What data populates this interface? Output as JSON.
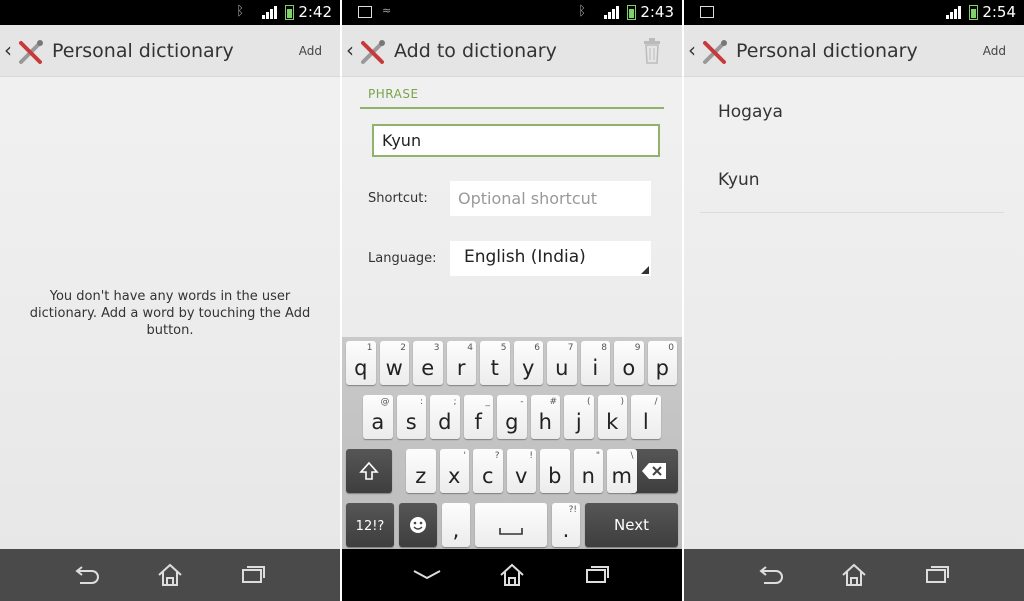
{
  "panel1": {
    "status_time": "2:42",
    "title": "Personal dictionary",
    "add_label": "Add",
    "empty_message": "You don't have any words in the user dictionary. Add a word by touching the Add button."
  },
  "panel2": {
    "status_time": "2:43",
    "title": "Add to dictionary",
    "phrase_label": "PHRASE",
    "phrase_value": "Kyun",
    "shortcut_label": "Shortcut:",
    "shortcut_placeholder": "Optional shortcut",
    "language_label": "Language:",
    "language_value": "English (India)",
    "keyboard": {
      "row1": [
        {
          "k": "q",
          "s": "1"
        },
        {
          "k": "w",
          "s": "2"
        },
        {
          "k": "e",
          "s": "3"
        },
        {
          "k": "r",
          "s": "4"
        },
        {
          "k": "t",
          "s": "5"
        },
        {
          "k": "y",
          "s": "6"
        },
        {
          "k": "u",
          "s": "7"
        },
        {
          "k": "i",
          "s": "8"
        },
        {
          "k": "o",
          "s": "9"
        },
        {
          "k": "p",
          "s": "0"
        }
      ],
      "row2": [
        {
          "k": "a",
          "s": "@"
        },
        {
          "k": "s",
          "s": ":"
        },
        {
          "k": "d",
          "s": ";"
        },
        {
          "k": "f",
          "s": "_"
        },
        {
          "k": "g",
          "s": "-"
        },
        {
          "k": "h",
          "s": "#"
        },
        {
          "k": "j",
          "s": "("
        },
        {
          "k": "k",
          "s": ")"
        },
        {
          "k": "l",
          "s": "/"
        }
      ],
      "row3": [
        {
          "k": "z",
          "s": ""
        },
        {
          "k": "x",
          "s": "'"
        },
        {
          "k": "c",
          "s": "?"
        },
        {
          "k": "v",
          "s": "!"
        },
        {
          "k": "b",
          "s": ""
        },
        {
          "k": "n",
          "s": "\""
        },
        {
          "k": "m",
          "s": "\\"
        }
      ],
      "symbols_label": "12!?",
      "comma_label": ",",
      "period_label": ".",
      "next_label": "Next"
    }
  },
  "panel3": {
    "status_time": "2:54",
    "title": "Personal dictionary",
    "add_label": "Add",
    "words": [
      "Hogaya",
      "Kyun"
    ]
  },
  "icons": [
    "back-chevron-icon",
    "settings-tools-icon",
    "trash-icon",
    "bluetooth-icon",
    "signal-icon",
    "battery-icon",
    "back-icon",
    "home-icon",
    "recent-apps-icon",
    "shift-icon",
    "backspace-icon",
    "emoji-icon",
    "space-icon",
    "hide-keyboard-icon"
  ],
  "colors": {
    "accent_green": "#8fb36a",
    "status_bar": "#000000",
    "nav_bar": "#4a4a4a",
    "action_bar": "#e5e5e5"
  }
}
